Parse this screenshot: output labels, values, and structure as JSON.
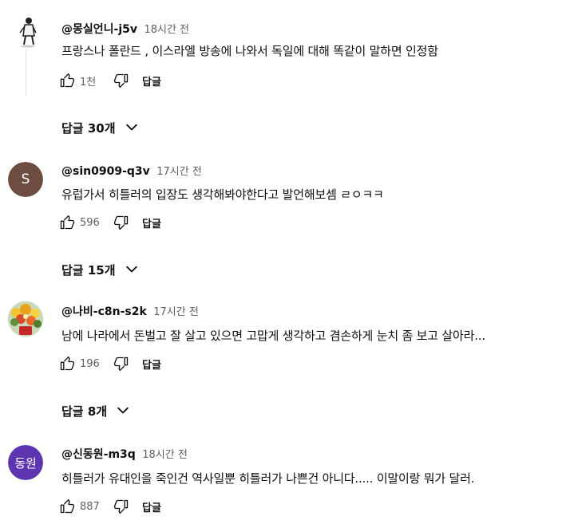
{
  "comments": [
    {
      "author": "@몽실언니-j5v",
      "time": "18시간 전",
      "text": "프랑스나 폴란드 , 이스라엘 방송에 나와서 독일에 대해 똑같이 말하면 인정함",
      "likes": "1천",
      "reply_label": "답글",
      "replies_label": "답글 30개",
      "avatar": {
        "type": "figure"
      }
    },
    {
      "author": "@sin0909-q3v",
      "time": "17시간 전",
      "text": "유럽가서 히틀러의 입장도 생각해봐야한다고 발언해보셈 ㄹㅇㅋㅋ",
      "likes": "596",
      "reply_label": "답글",
      "replies_label": "답글 15개",
      "avatar": {
        "type": "letter",
        "letter": "S",
        "color": "#6d4c41"
      }
    },
    {
      "author": "@나비-c8n-s2k",
      "time": "17시간 전",
      "text": "남에 나라에서 돈벌고 잘 살고 있으면 고맙게 생각하고 겸손하게 눈치 좀 보고 살아라...",
      "likes": "196",
      "reply_label": "답글",
      "replies_label": "답글 8개",
      "avatar": {
        "type": "flowers"
      }
    },
    {
      "author": "@신동원-m3q",
      "time": "18시간 전",
      "text": "히틀러가 유대인을 죽인건 역사일뿐 히틀러가 나쁜건 아니다.....  이말이랑 뭐가 달러.",
      "likes": "887",
      "reply_label": "답글",
      "avatar": {
        "type": "letter",
        "letter": "동원",
        "color": "#5e35b1"
      }
    }
  ],
  "colors": {
    "text_primary": "#0f0f0f",
    "text_secondary": "#606060",
    "thread_line": "#e0e0e0"
  },
  "icons": [
    "like-icon",
    "dislike-icon",
    "chevron-down-icon"
  ]
}
